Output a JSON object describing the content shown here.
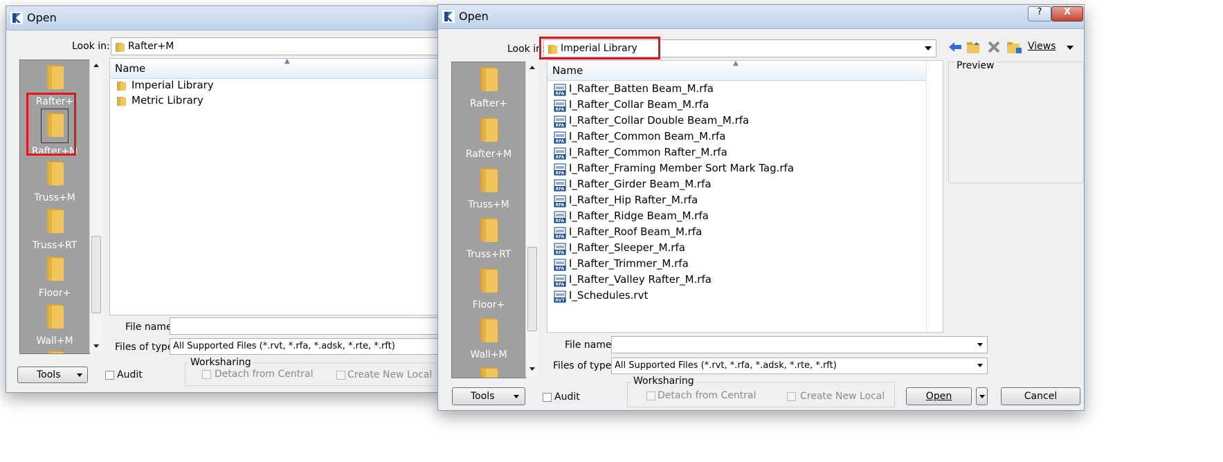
{
  "left_dialog": {
    "title": "Open",
    "look_in_label": "Look in:",
    "look_in_value": "Rafter+M",
    "places": [
      "Rafter+",
      "Rafter+M",
      "Truss+M",
      "Truss+RT",
      "Floor+",
      "Wall+M"
    ],
    "column_name": "Name",
    "files": [
      "Imperial Library",
      "Metric Library"
    ],
    "file_name_label": "File name:",
    "file_name_value": "",
    "files_of_type_label": "Files of type:",
    "files_of_type_value": "All Supported Files  (*.rvt, *.rfa, *.adsk, *.rte, *.rft)",
    "tools_label": "Tools",
    "audit_label": "Audit",
    "worksharing_label": "Worksharing",
    "detach_label": "Detach from Central",
    "create_local_label": "Create New Local"
  },
  "right_dialog": {
    "title": "Open",
    "help_label": "?",
    "close_label": "X",
    "look_in_label": "Look in:",
    "look_in_value": "Imperial Library",
    "views_label": "Views",
    "preview_label": "Preview",
    "places": [
      "Rafter+",
      "Rafter+M",
      "Truss+M",
      "Truss+RT",
      "Floor+",
      "Wall+M"
    ],
    "column_name": "Name",
    "files": [
      {
        "name": "I_Rafter_Batten Beam_M.rfa",
        "icon": "rfa-file-icon"
      },
      {
        "name": "I_Rafter_Collar Beam_M.rfa",
        "icon": "rfa-file-icon"
      },
      {
        "name": "I_Rafter_Collar Double Beam_M.rfa",
        "icon": "rfa-file-icon"
      },
      {
        "name": "I_Rafter_Common Beam_M.rfa",
        "icon": "rfa-file-icon"
      },
      {
        "name": "I_Rafter_Common Rafter_M.rfa",
        "icon": "rfa-file-icon"
      },
      {
        "name": "I_Rafter_Framing Member Sort Mark Tag.rfa",
        "icon": "rfa-file-icon"
      },
      {
        "name": "I_Rafter_Girder Beam_M.rfa",
        "icon": "rfa-file-icon"
      },
      {
        "name": "I_Rafter_Hip Rafter_M.rfa",
        "icon": "rfa-file-icon"
      },
      {
        "name": "I_Rafter_Ridge Beam_M.rfa",
        "icon": "rfa-file-icon"
      },
      {
        "name": "I_Rafter_Roof Beam_M.rfa",
        "icon": "rfa-file-icon"
      },
      {
        "name": "I_Rafter_Sleeper_M.rfa",
        "icon": "rfa-file-icon"
      },
      {
        "name": "I_Rafter_Trimmer_M.rfa",
        "icon": "rfa-file-icon"
      },
      {
        "name": "I_Rafter_Valley Rafter_M.rfa",
        "icon": "rfa-file-icon"
      },
      {
        "name": "I_Schedules.rvt",
        "icon": "rvt-file-icon"
      }
    ],
    "file_name_label": "File name:",
    "file_name_value": "",
    "files_of_type_label": "Files of type:",
    "files_of_type_value": "All Supported Files  (*.rvt, *.rfa, *.adsk, *.rte, *.rft)",
    "tools_label": "Tools",
    "audit_label": "Audit",
    "worksharing_label": "Worksharing",
    "detach_label": "Detach from Central",
    "create_local_label": "Create New Local",
    "open_label": "Open",
    "cancel_label": "Cancel"
  },
  "colors": {
    "highlight": "#e0141e",
    "folder": "#f2c55c",
    "places_bg": "#a0a0a0",
    "rfa_icon": "#2f5d9b"
  }
}
